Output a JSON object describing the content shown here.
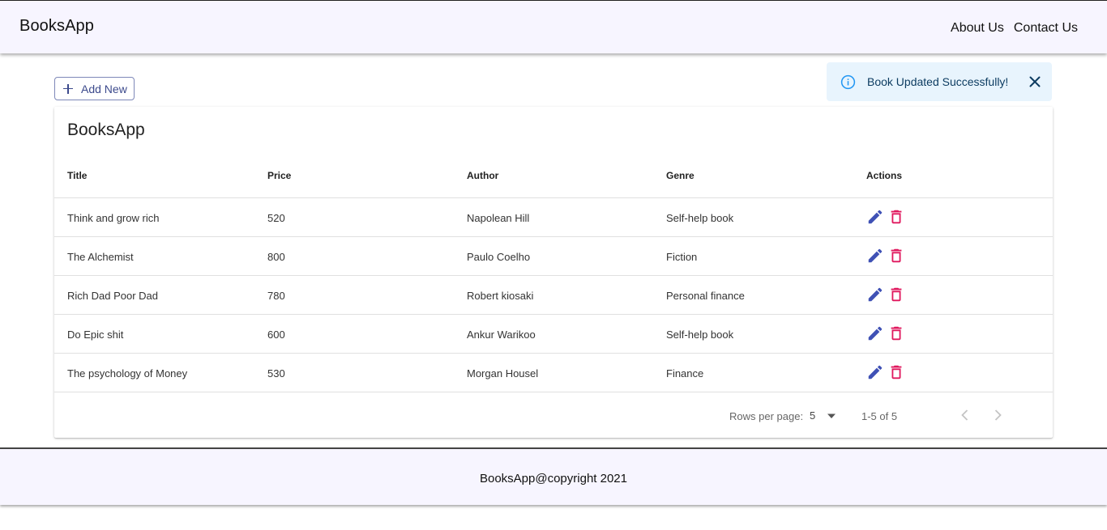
{
  "header": {
    "brand": "BooksApp",
    "nav": [
      "About Us",
      "Contact Us"
    ]
  },
  "toolbar": {
    "add_label": "Add New"
  },
  "alert": {
    "message": "Book Updated Successfully!",
    "icon": "info-icon",
    "close_icon": "close-icon",
    "color": "#2196f3"
  },
  "table": {
    "title": "BooksApp",
    "columns": [
      "Title",
      "Price",
      "Author",
      "Genre",
      "Actions"
    ],
    "rows": [
      {
        "title": "Think and grow rich",
        "price": "520",
        "author": "Napolean Hill",
        "genre": "Self-help book"
      },
      {
        "title": "The Alchemist",
        "price": "800",
        "author": "Paulo Coelho",
        "genre": "Fiction"
      },
      {
        "title": "Rich Dad Poor Dad",
        "price": "780",
        "author": "Robert kiosaki",
        "genre": "Personal finance"
      },
      {
        "title": "Do Epic shit",
        "price": "600",
        "author": "Ankur Warikoo",
        "genre": "Self-help book"
      },
      {
        "title": "The psychology of Money",
        "price": "530",
        "author": "Morgan Housel",
        "genre": "Finance"
      }
    ],
    "action_icons": [
      "edit-icon",
      "delete-icon"
    ],
    "edit_color": "#3f51b5",
    "delete_color": "#e0185e"
  },
  "pagination": {
    "rows_per_page_label": "Rows per page:",
    "rows_per_page_value": "5",
    "range": "1-5 of 5"
  },
  "footer": {
    "text": "BooksApp@copyright 2021"
  }
}
